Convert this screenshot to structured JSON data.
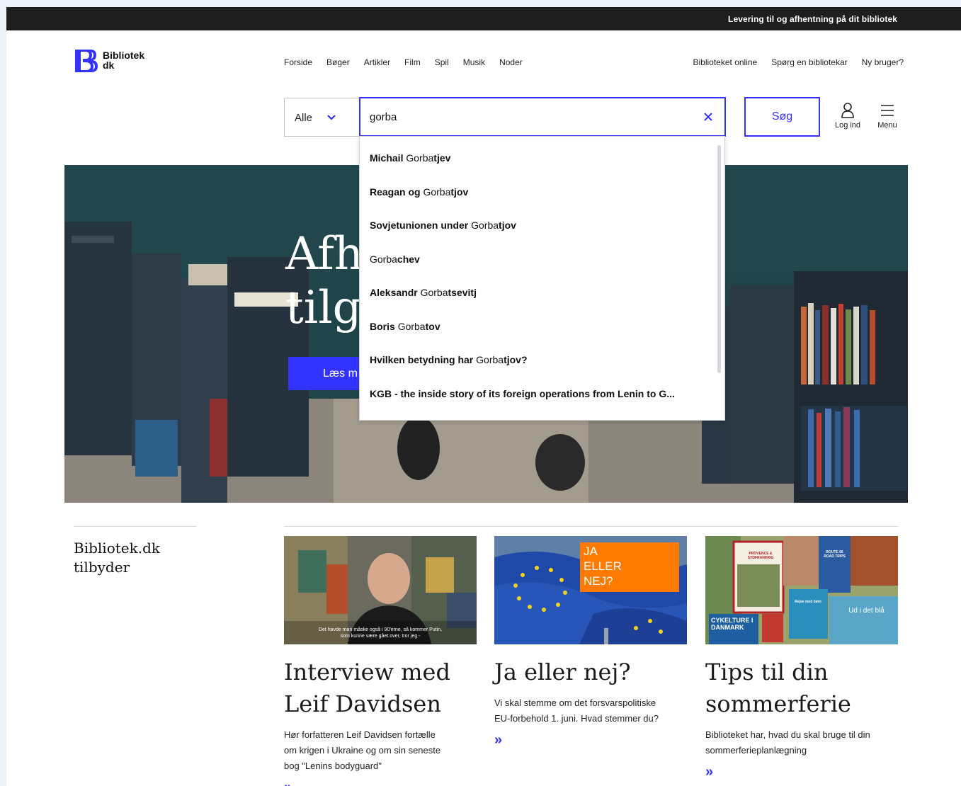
{
  "topbar": {
    "text": "Levering til og afhentning på dit bibliotek"
  },
  "logo": {
    "line1": "Bibliotek",
    "line2": "dk"
  },
  "nav": {
    "main": [
      "Forside",
      "Bøger",
      "Artikler",
      "Film",
      "Spil",
      "Musik",
      "Noder"
    ],
    "secondary": [
      "Biblioteket online",
      "Spørg en bibliotekar",
      "Ny bruger?"
    ]
  },
  "search": {
    "scope_label": "Alle",
    "query": "gorba",
    "submit_label": "Søg"
  },
  "actions": {
    "login_label": "Log ind",
    "menu_label": "Menu"
  },
  "suggestions": [
    {
      "before": "Michail ",
      "match": "Gorba",
      "after": "tjev"
    },
    {
      "before": "Reagan og ",
      "match": "Gorba",
      "after": "tjov"
    },
    {
      "before": "Sovjetunionen under ",
      "match": "Gorba",
      "after": "tjov"
    },
    {
      "before": "",
      "match": "Gorba",
      "after": "chev"
    },
    {
      "before": "Aleksandr ",
      "match": "Gorba",
      "after": "tsevitj"
    },
    {
      "before": "Boris ",
      "match": "Gorba",
      "after": "tov"
    },
    {
      "before": "Hvilken betydning har ",
      "match": "Gorba",
      "after": "tjov?"
    },
    {
      "before": "KGB - the inside story of its foreign operations from Lenin to G...",
      "match": "",
      "after": ""
    }
  ],
  "hero": {
    "title_line1": "Afh",
    "title_line2": "tilg",
    "button_label": "Læs m"
  },
  "offers": {
    "heading_line1": "Bibliotek.dk",
    "heading_line2": "tilbyder"
  },
  "cards": [
    {
      "title_line1": "Interview med",
      "title_line2": "Leif Davidsen",
      "text_lines": [
        "Hør forfatteren Leif Davidsen fortælle",
        "om krigen i Ukraine og om sin seneste",
        "bog \"Lenins bodyguard\""
      ],
      "subtitle_line1": "Det havde man måske også i 90'erne, så kommer Putin,",
      "subtitle_line2": "som kunne være gået over, tror jeg -"
    },
    {
      "title_line1": "Ja eller nej?",
      "title_line2": "",
      "text_lines": [
        "Vi skal stemme om det forsvarspolitiske",
        "EU-forbehold 1. juni. Hvad stemmer du?"
      ],
      "badge_lines": [
        "JA",
        "ELLER",
        "NEJ?"
      ]
    },
    {
      "title_line1": "Tips til din",
      "title_line2": "sommerferie",
      "text_lines": [
        "Biblioteket har, hvad du skal bruge til din",
        "sommerferieplanlægning"
      ],
      "covers": [
        "PROVENCE & SYDFRANKRIG",
        "ROUTE 66 ROAD TRIPS",
        "Rejse med børn",
        "CYKELTURE I DANMARK",
        "Ud i det blå"
      ]
    }
  ],
  "arrow_glyph": "»",
  "colors": {
    "accent": "#3333ff",
    "topbar": "#1e1e1e",
    "badge": "#ff7a00"
  }
}
